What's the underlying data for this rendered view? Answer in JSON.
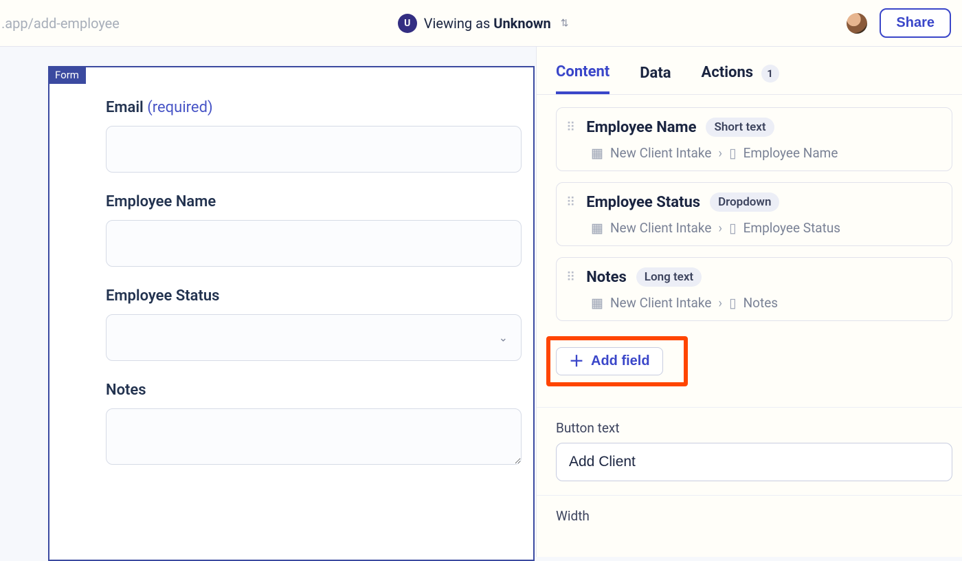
{
  "topbar": {
    "url": ".app/add-employee",
    "u_badge": "U",
    "viewing_prefix": "Viewing as ",
    "viewing_name": "Unknown",
    "share_label": "Share"
  },
  "canvas": {
    "tag": "Form",
    "fields": [
      {
        "label": "Email",
        "required_text": "(required)",
        "type": "text"
      },
      {
        "label": "Employee Name",
        "type": "text"
      },
      {
        "label": "Employee Status",
        "type": "select"
      },
      {
        "label": "Notes",
        "type": "textarea"
      }
    ]
  },
  "panel": {
    "tabs": {
      "content": "Content",
      "data": "Data",
      "actions": "Actions",
      "actions_count": "1"
    },
    "fields": [
      {
        "name": "Employee Name",
        "type": "Short text",
        "source_table": "New Client Intake",
        "source_col": "Employee Name"
      },
      {
        "name": "Employee Status",
        "type": "Dropdown",
        "source_table": "New Client Intake",
        "source_col": "Employee Status"
      },
      {
        "name": "Notes",
        "type": "Long text",
        "source_table": "New Client Intake",
        "source_col": "Notes"
      }
    ],
    "add_field_label": "Add field",
    "button_text_label": "Button text",
    "button_text_value": "Add Client",
    "width_label": "Width"
  }
}
